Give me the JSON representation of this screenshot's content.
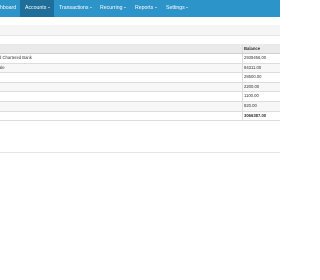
{
  "navbar": {
    "items": [
      {
        "label": "hboard"
      },
      {
        "label": "Accounts"
      },
      {
        "label": "Transactions"
      },
      {
        "label": "Recurring"
      },
      {
        "label": "Reports"
      },
      {
        "label": "Settings"
      }
    ]
  },
  "table": {
    "header": {
      "name": "",
      "balance": "Balance"
    },
    "rows": [
      {
        "name": "d Chartered Bank",
        "balance": "2939456.00"
      },
      {
        "name": "ale",
        "balance": "94311.00"
      },
      {
        "name": "",
        "balance": "28500.00"
      },
      {
        "name": "",
        "balance": "2200.00"
      },
      {
        "name": "",
        "balance": "1100.00"
      },
      {
        "name": "",
        "balance": "820.00"
      }
    ],
    "total": {
      "name": "",
      "balance": "3066387.00"
    }
  },
  "colors": {
    "navbar": "#2d94c9",
    "navbar_active": "#1f6e99"
  }
}
